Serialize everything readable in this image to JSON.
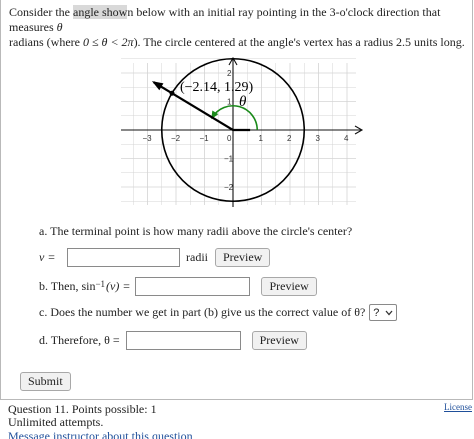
{
  "prompt": {
    "part1": "Consider the ",
    "highlight": "angle show",
    "part2": "n below with an initial ray pointing in the 3-o'clock direction that measures ",
    "theta": "θ",
    "part3": "radians (where ",
    "range": "0 ≤ θ < 2π",
    "part4": "). The circle centered at the angle's vertex has a radius 2.5 units long."
  },
  "graph": {
    "point_label": "(−2.14, 1.29)",
    "angle_label": "θ",
    "x_ticks": [
      "−3",
      "−2",
      "−1",
      "0",
      "1",
      "2",
      "3",
      "4"
    ],
    "y_ticks": [
      "2",
      "1",
      "−1",
      "−2"
    ],
    "radius": 2.5,
    "point": {
      "x": -2.14,
      "y": 1.29
    },
    "colors": {
      "ray": "#000000",
      "circle": "#000000",
      "arc": "#1a8a1a",
      "grid": "#d4d4d4"
    }
  },
  "questions": {
    "a": {
      "text": "a. The terminal point is how many radii above the circle's center?",
      "var": "v =",
      "unit": "radii",
      "preview": "Preview",
      "value": ""
    },
    "b": {
      "text": "b. Then, sin",
      "sup": "−1",
      "arg": "(v) =",
      "preview": "Preview",
      "value": ""
    },
    "c": {
      "text": "c. Does the number we get in part (b) give us the correct value of θ?",
      "select_value": "?",
      "select_icon": "chevron-down"
    },
    "d": {
      "text": "d. Therefore, θ =",
      "preview": "Preview",
      "value": ""
    }
  },
  "submit_label": "Submit",
  "footer": {
    "question": "Question 11. Points possible: 1",
    "attempts": "Unlimited attempts.",
    "message_link": "Message instructor about this question",
    "license": "License"
  }
}
